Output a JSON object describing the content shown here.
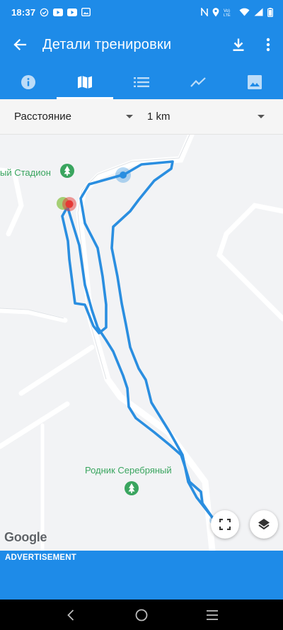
{
  "status_bar": {
    "time": "18:37",
    "left_icons": [
      "check-circle-icon",
      "youtube-icon",
      "youtube-icon",
      "gallery-icon"
    ],
    "right_icons": [
      "nfc-icon",
      "location-icon",
      "volte-icon",
      "wifi-icon",
      "signal-icon",
      "battery-icon"
    ]
  },
  "app_bar": {
    "title": "Детали тренировки",
    "back_icon": "arrow-back-icon",
    "actions": [
      "download-icon",
      "more-vert-icon"
    ]
  },
  "tabs": [
    {
      "icon": "info-icon",
      "active": false
    },
    {
      "icon": "map-icon",
      "active": true
    },
    {
      "icon": "list-icon",
      "active": false
    },
    {
      "icon": "chart-icon",
      "active": false
    },
    {
      "icon": "image-icon",
      "active": false
    }
  ],
  "filters": {
    "metric": "Расстояние",
    "interval": "1 km"
  },
  "map": {
    "poi": [
      {
        "label": "ый Стадион"
      },
      {
        "label": "Родник Серебряный"
      }
    ],
    "route_color": "#2a8ee0",
    "start_color": "#8bc34a",
    "end_color": "#e53935",
    "marker_color": "#2a8ee0",
    "attribution": "Google"
  },
  "ad": {
    "label": "ADVERTISEMENT"
  },
  "colors": {
    "primary": "#1e8be8",
    "poi_green": "#3aa55f"
  }
}
